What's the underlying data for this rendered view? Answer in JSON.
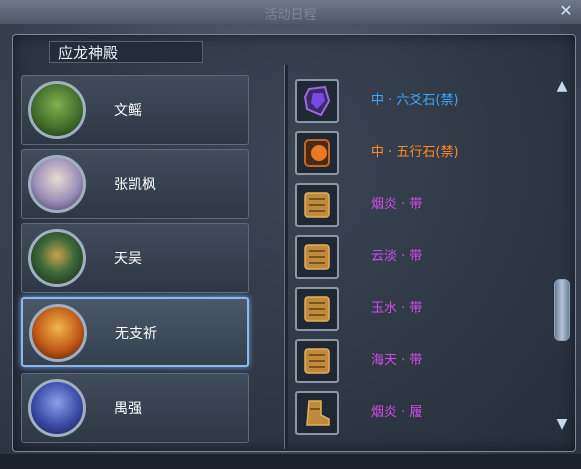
{
  "window": {
    "title": "活动日程"
  },
  "header": {
    "title": "应龙神殿"
  },
  "bosses": [
    {
      "name": "文鳐",
      "selected": false,
      "icon": "green-ogre-portrait"
    },
    {
      "name": "张凯枫",
      "selected": false,
      "icon": "white-haired-swordsman-portrait"
    },
    {
      "name": "天吴",
      "selected": false,
      "icon": "green-beast-portrait"
    },
    {
      "name": "无支祈",
      "selected": true,
      "icon": "golden-warrior-portrait"
    },
    {
      "name": "禺强",
      "selected": false,
      "icon": "blue-demon-portrait"
    }
  ],
  "items": [
    {
      "name": "中 · 六爻石(禁)",
      "color": "#3aa8ff",
      "icon": "purple-stone-icon"
    },
    {
      "name": "中 · 五行石(禁)",
      "color": "#ff8a2a",
      "icon": "orange-stone-icon"
    },
    {
      "name": "烟炎 · 带",
      "color": "#d04ee8",
      "icon": "belt-icon"
    },
    {
      "name": "云淡 · 带",
      "color": "#d04ee8",
      "icon": "belt-icon"
    },
    {
      "name": "玉水 · 带",
      "color": "#d04ee8",
      "icon": "belt-icon"
    },
    {
      "name": "海天 · 带",
      "color": "#d04ee8",
      "icon": "belt-icon"
    },
    {
      "name": "烟炎 · 履",
      "color": "#d04ee8",
      "icon": "boots-icon"
    }
  ]
}
